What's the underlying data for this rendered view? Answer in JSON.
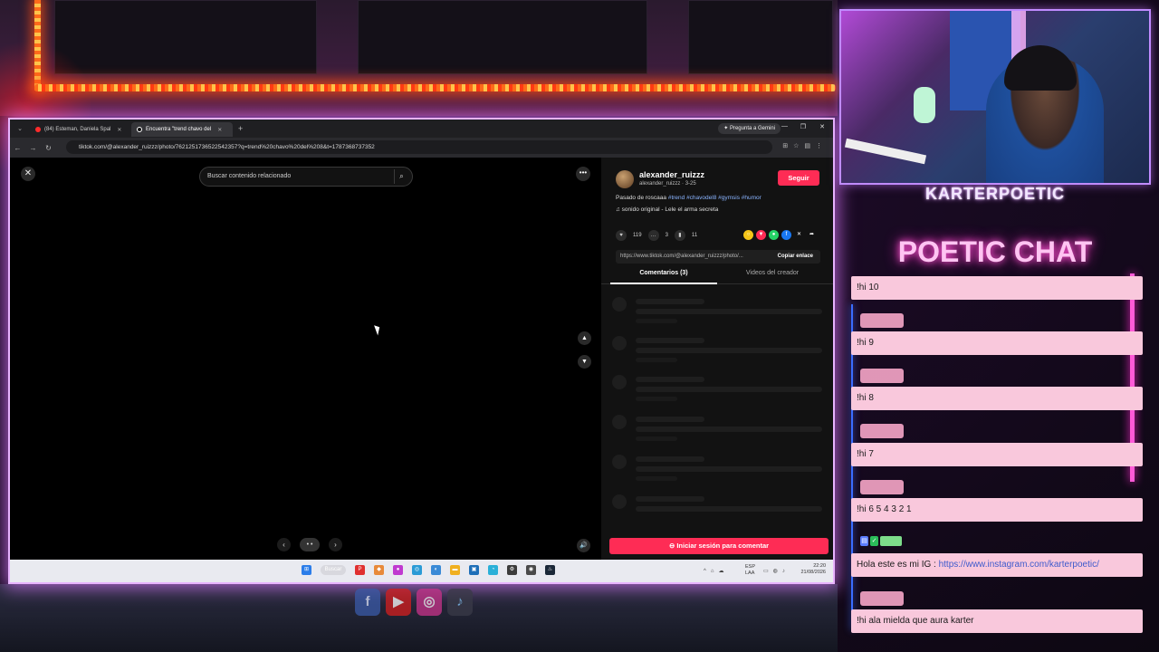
{
  "browser": {
    "tabs": [
      {
        "label": "(84) Esteman, Daniela Spal",
        "icon": "youtube-icon",
        "active": false
      },
      {
        "label": "Encuentra \"trend chavo del",
        "icon": "tiktok-icon",
        "active": true
      }
    ],
    "gemini_label": "Pregunta a Gemini",
    "url": "tiktok.com/@alexander_ruizzz/photo/7621251736522542357?q=trend%20chavo%20del%208&t=1787368737352"
  },
  "video": {
    "search_placeholder": "Buscar contenido relacionado",
    "more_label": "•••",
    "up_label": "▲",
    "down_label": "▼",
    "prev_label": "‹",
    "next_label": "›",
    "dots_label": "• •",
    "volume_label": "🔊",
    "close_label": "✕"
  },
  "post": {
    "username": "alexander_ruizzz",
    "handle_date": "alexander_ruizzz · 3-25",
    "follow_label": "Seguir",
    "description": "Pasado de roscaaa ",
    "hashtags": "#trend #chavodel8 #gymsis #humor",
    "sound": "♫  sonido original - Lele el arma secreta",
    "likes": "119",
    "comments": "3",
    "saves": "11",
    "link": "https://www.tiktok.com/@alexander_ruizzz/photo/...",
    "copy_link_label": "Copiar enlace",
    "tab_comments": "Comentarios (3)",
    "tab_creator_videos": "Videos del creador",
    "login_label": "⊖ Iniciar sesión para comentar"
  },
  "taskbar": {
    "search_label": "Buscar",
    "lang_top": "ESP",
    "lang_bottom": "LAA",
    "time": "22:20",
    "date": "21/08/2026"
  },
  "overlay": {
    "streamer_name": "KARTERPOETIC",
    "chat_title": "POETIC CHAT",
    "messages": [
      "!hi 10",
      "!hi 9",
      "!hi 8",
      "!hi 7",
      "!hi 6 5 4 3 2 1",
      "Hola este es mi IG : ",
      "!hi ala mielda que aura karter"
    ],
    "ig_link": "https://www.instagram.com/karterpoetic/"
  },
  "colors": {
    "tiktok_red": "#fe2c55",
    "chat_pink": "#f9c8dc",
    "neon_border": "#e8b4ff"
  }
}
